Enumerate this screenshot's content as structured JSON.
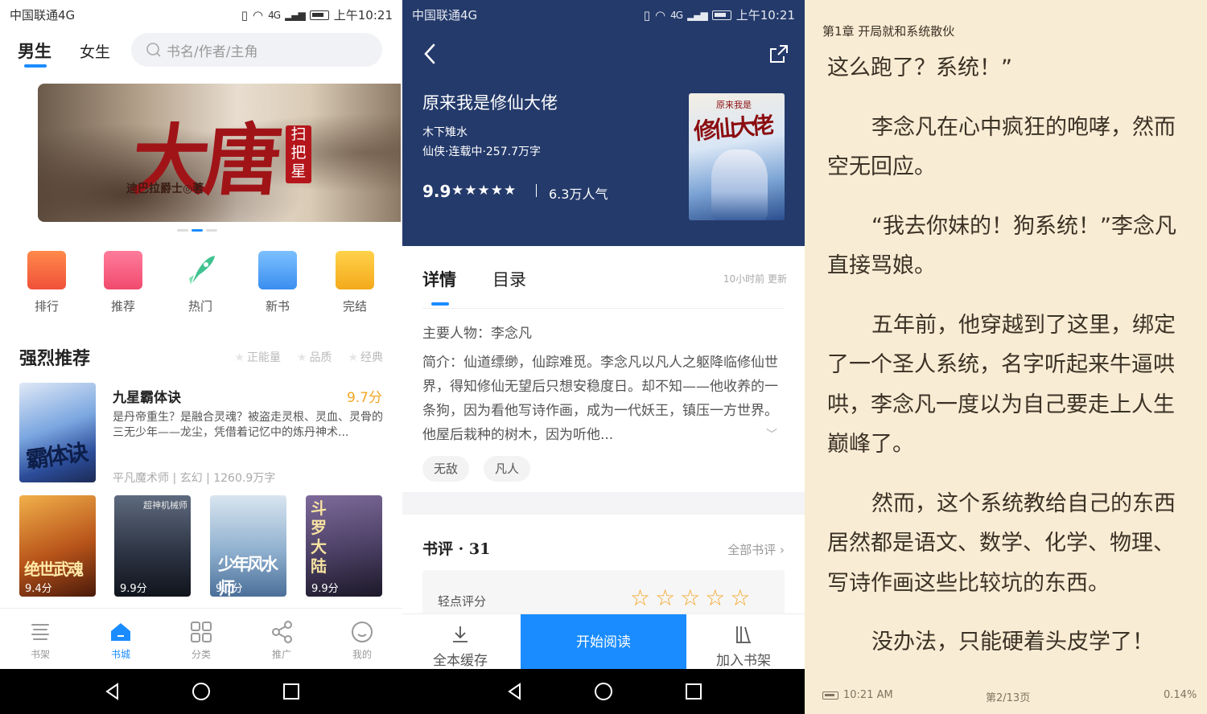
{
  "status_bar": {
    "carrier": "中国联通4G",
    "network": "4G",
    "time": "上午10:21"
  },
  "store": {
    "tabs": [
      "男生",
      "女生"
    ],
    "search_placeholder": "书名/作者/主角",
    "banner": {
      "title": "大唐",
      "stamp": "扫把星",
      "author": "迪巴拉爵士◎著"
    },
    "categories": [
      "排行",
      "推荐",
      "热门",
      "新书",
      "完结"
    ],
    "section_title": "强烈推荐",
    "filters": [
      "正能量",
      "品质",
      "经典"
    ],
    "featured": {
      "cover_title": "霸体诀",
      "title": "九星霸体诀",
      "score": "9.7分",
      "desc": "是丹帝重生？是融合灵魂？被盗走灵根、灵血、灵骨的三无少年——龙尘，凭借着记忆中的炼丹神术...",
      "meta": "平凡魔术师 | 玄幻 | 1260.9万字"
    },
    "thumbs": [
      {
        "title": "绝世武魂",
        "score": "9.4分",
        "color": "#b8541a"
      },
      {
        "title": "超神机械师",
        "score": "9.9分",
        "color": "#2a3140"
      },
      {
        "title": "少年风水师",
        "score": "9.7分",
        "color": "#8fb0cf"
      },
      {
        "title": "斗罗大陆",
        "score": "9.9分",
        "color": "#4a3f63"
      }
    ],
    "tabbar": [
      "书架",
      "书城",
      "分类",
      "推广",
      "我的"
    ]
  },
  "detail": {
    "title": "原来我是修仙大佬",
    "author": "木下雉水",
    "meta": "仙侠·连载中·257.7万字",
    "score": "9.9",
    "stars": "★★★★★",
    "popularity": "6.3万人气",
    "cover_title": "修仙大佬",
    "cover_sub": "原来我是",
    "tabs": [
      "详情",
      "目录"
    ],
    "updated": "10小时前 更新",
    "lead": "主要人物：李念凡",
    "intro": "简介：仙道缥缈，仙踪难觅。李念凡以凡人之躯降临修仙世界，得知修仙无望后只想安稳度日。却不知——他收养的一条狗，因为看他写诗作画，成为一代妖王，镇压一方世界。他屋后栽种的树木，因为听他...",
    "tags": [
      "无敌",
      "凡人"
    ],
    "review_title": "书评 · 31",
    "review_all": "全部书评",
    "rating_label": "轻点评分",
    "rating_stars": "☆☆☆☆☆",
    "actions": {
      "cache": "全本缓存",
      "read": "开始阅读",
      "shelf": "加入书架"
    }
  },
  "reader": {
    "chapter": "第1章 开局就和系统散伙",
    "paragraphs": [
      "这么跑了？系统！”",
      "李念凡在心中疯狂的咆哮，然而空无回应。",
      "“我去你妹的！狗系统！”李念凡直接骂娘。",
      "五年前，他穿越到了这里，绑定了一个圣人系统，名字听起来牛逼哄哄，李念凡一度以为自己要走上人生巅峰了。",
      "然而，这个系统教给自己的东西居然都是语文、数学、化学、物理、写诗作画这些比较坑的东西。",
      "没办法，只能硬着头皮学了！"
    ],
    "time": "10:21 AM",
    "page": "第2/13页",
    "progress": "0.14%"
  }
}
